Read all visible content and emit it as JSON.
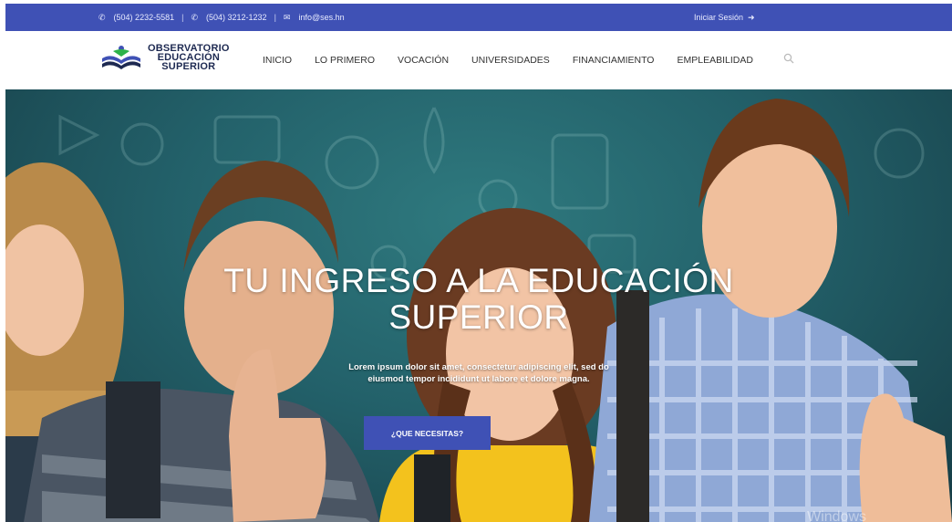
{
  "topbar": {
    "phone1": "(504) 2232-5581",
    "phone2": "(504) 3212-1232",
    "email": "info@ses.hn",
    "separator": "|",
    "login": "Iniciar Sesión",
    "phone_icon": "phone-icon",
    "mail_icon": "mail-icon",
    "login_icon": "sign-in-icon",
    "bg_color": "#3f51b5"
  },
  "logo": {
    "line1": "OBSERVATORIO",
    "line2": "EDUCACIÓN",
    "line3": "SUPERIOR"
  },
  "nav": {
    "items": [
      "INICIO",
      "LO PRIMERO",
      "VOCACIÓN",
      "UNIVERSIDADES",
      "FINANCIAMIENTO",
      "EMPLEABILIDAD"
    ],
    "search_icon": "search-icon"
  },
  "hero": {
    "title_line1": "TU INGRESO A LA EDUCACIÓN",
    "title_line2": "SUPERIOR",
    "desc_line1": "Lorem ipsum dolor sit amet, consectetur adipiscing elit, sed do",
    "desc_line2": "eiusmod tempor incididunt ut labore et dolore magna.",
    "cta": "¿QUE NECESITAS?",
    "accent_color": "#3f51b5",
    "watermark": "Windows"
  }
}
